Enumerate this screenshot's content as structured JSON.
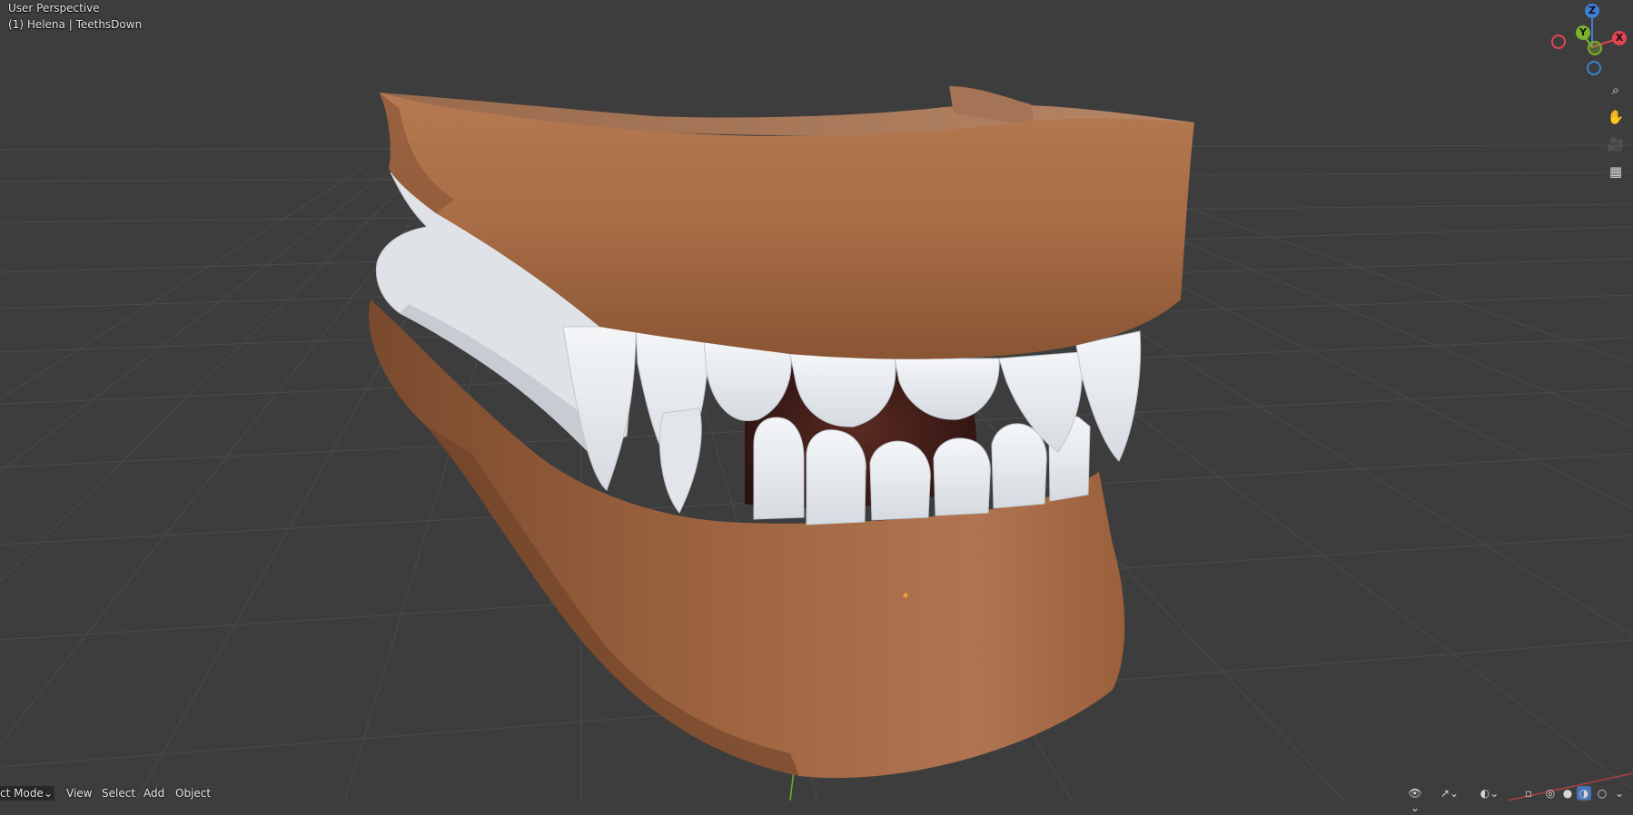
{
  "viewport": {
    "view_name": "User Perspective",
    "active_object": "(1) Helena | TeethsDown"
  },
  "gizmo": {
    "z": "Z",
    "y": "Y",
    "x": "X",
    "colors": {
      "x": "#e34452",
      "y": "#79b22b",
      "z": "#3c7fd6"
    }
  },
  "nav_buttons": [
    {
      "name": "zoom-icon",
      "glyph": "⌕"
    },
    {
      "name": "pan-hand-icon",
      "glyph": "✋"
    },
    {
      "name": "camera-icon",
      "glyph": "🎥"
    },
    {
      "name": "grid-ortho-icon",
      "glyph": "▦"
    }
  ],
  "header": {
    "mode": "ct Mode",
    "mode_arrow": "⌄",
    "menus": [
      "View",
      "Select",
      "Add",
      "Object"
    ]
  },
  "header_right_icons": [
    "visibility-icon",
    "gizmo-toggle-icon",
    "overlay-toggle-icon",
    "xray-icon",
    "wireframe-shading-icon",
    "solid-shading-icon",
    "material-shading-icon",
    "rendered-shading-icon"
  ],
  "colors": {
    "background": "#3d3d3d",
    "grid": "#4a4a4a",
    "skin": "#a86a44",
    "teeth": "#e6e9ed",
    "origin": "#f0a030"
  }
}
